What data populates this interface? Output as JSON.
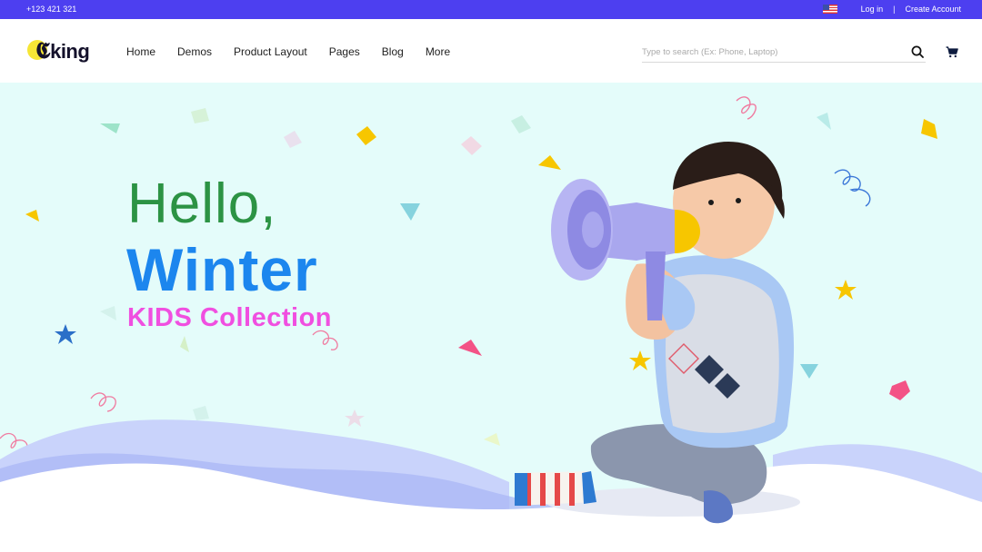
{
  "topbar": {
    "phone": "+123 421 321",
    "login": "Log in",
    "separator": "|",
    "create_account": "Create Account"
  },
  "brand": {
    "name": "king"
  },
  "nav": {
    "items": [
      {
        "label": "Home"
      },
      {
        "label": "Demos"
      },
      {
        "label": "Product Layout"
      },
      {
        "label": "Pages"
      },
      {
        "label": "Blog"
      },
      {
        "label": "More"
      }
    ]
  },
  "search": {
    "placeholder": "Type to search (Ex: Phone, Laptop)"
  },
  "hero": {
    "line1": "Hello,",
    "line2": "Winter",
    "line3": "KIDS Collection"
  },
  "colors": {
    "topbar": "#4d3ff0",
    "hero_bg": "#e4fcfa",
    "hello": "#2c9344",
    "winter": "#1c86ee",
    "kids": "#f04fe0",
    "wave": "#c9d3fb"
  }
}
